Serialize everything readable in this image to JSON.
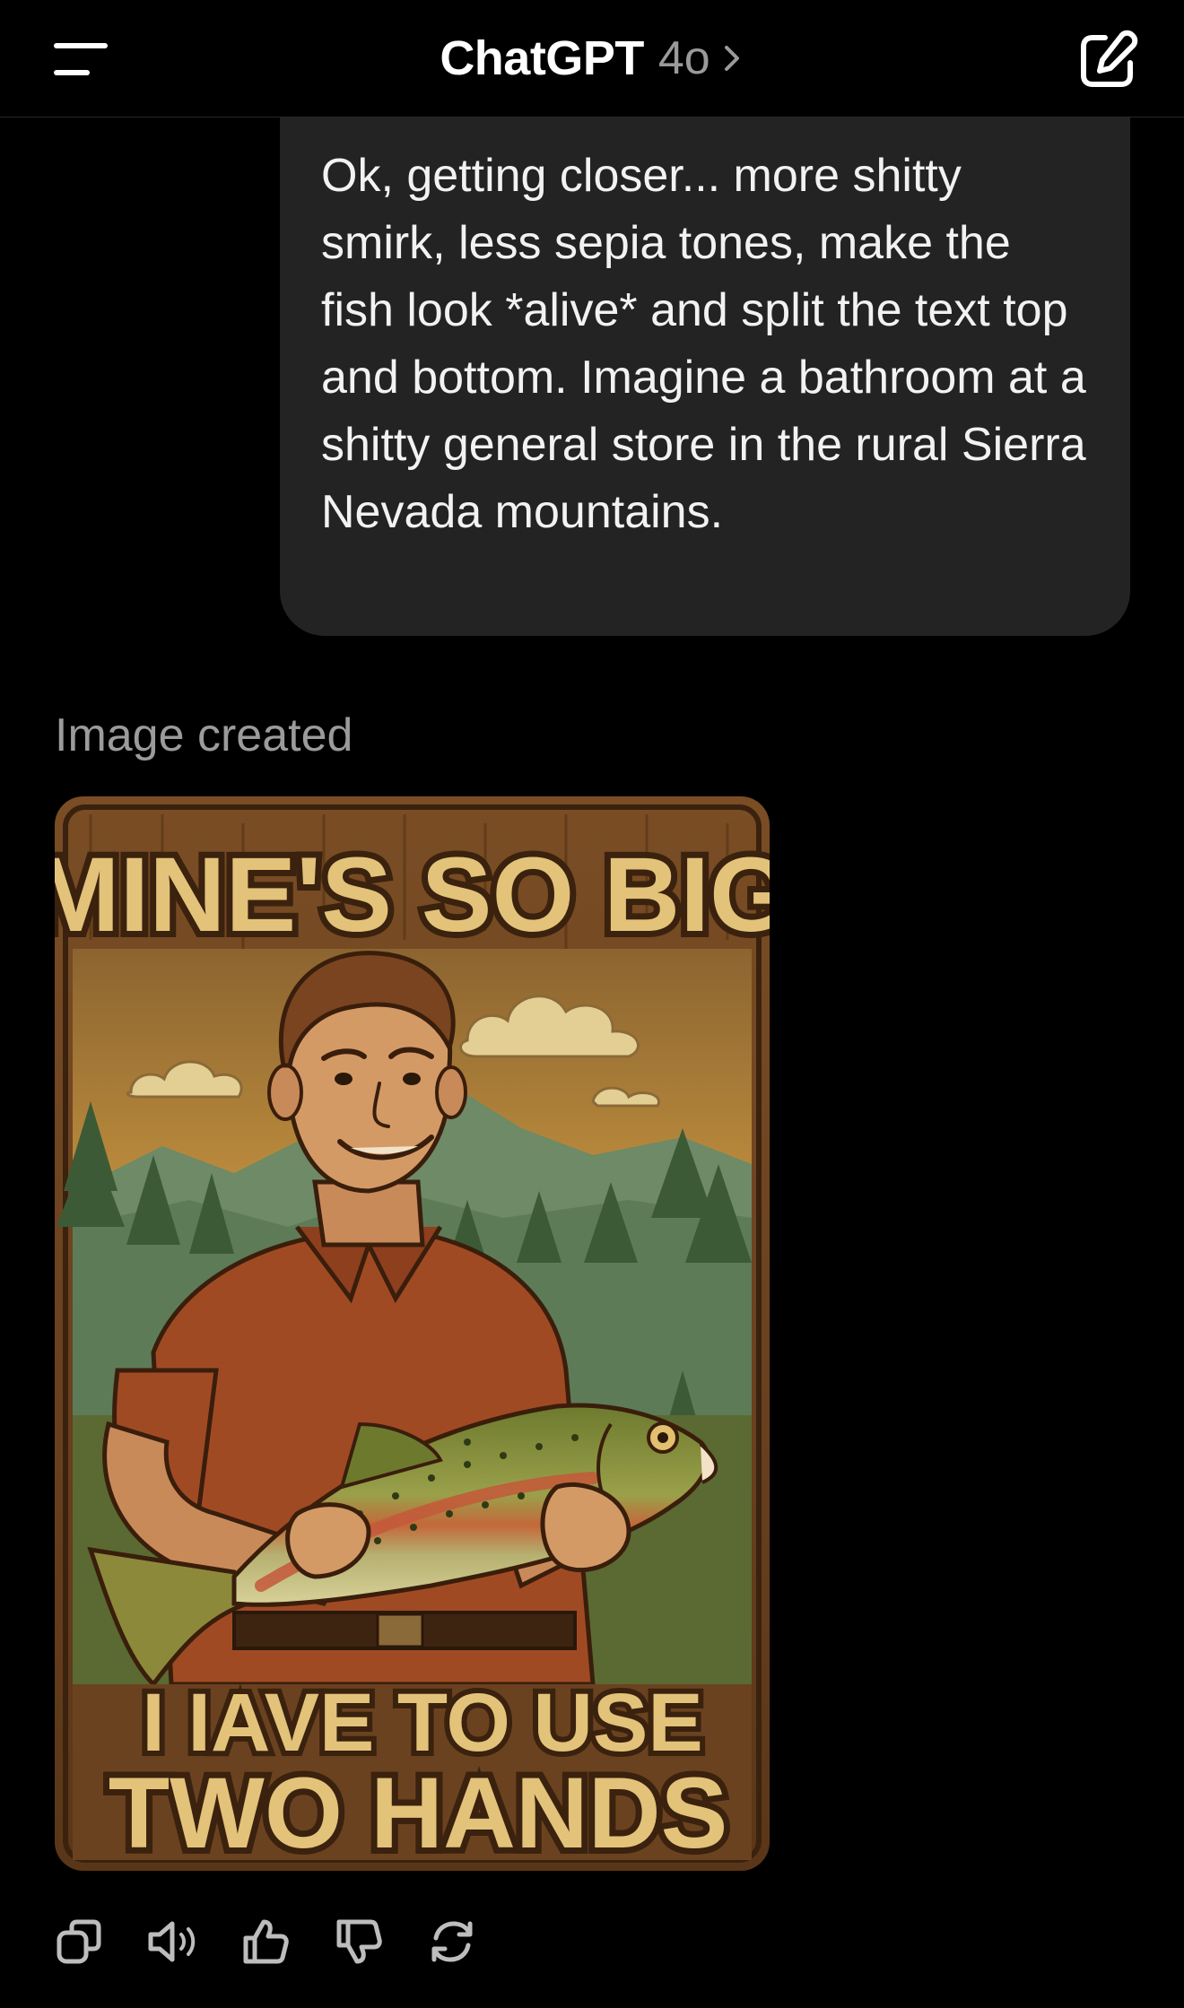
{
  "header": {
    "app_title": "ChatGPT",
    "model_label": "4o",
    "menu_icon": "hamburger-menu-icon",
    "model_chevron_icon": "chevron-right-icon",
    "new_chat_icon": "edit-compose-icon"
  },
  "conversation": {
    "user_message": "Ok, getting closer... more shitty smirk, less sepia tones, make the fish look *alive* and split the text top and bottom. Imagine a bathroom at a shitty general store in the rural Sierra Nevada mountains.",
    "assistant_status": "Image created",
    "generated_image": {
      "top_text": "MINE'S SO BIG",
      "bottom_text_line1": "I IAVE TO USE",
      "bottom_text_line2": "TWO HANDS"
    }
  },
  "actions": [
    {
      "icon": "copy-icon"
    },
    {
      "icon": "read-aloud-speaker-icon"
    },
    {
      "icon": "thumbs-up-icon"
    },
    {
      "icon": "thumbs-down-icon"
    },
    {
      "icon": "regenerate-icon"
    }
  ],
  "colors": {
    "background": "#000000",
    "bubble": "#232323",
    "muted_text": "#9b9b9b",
    "poster_wood": "#6b4423",
    "poster_text": "#e3c27a"
  }
}
